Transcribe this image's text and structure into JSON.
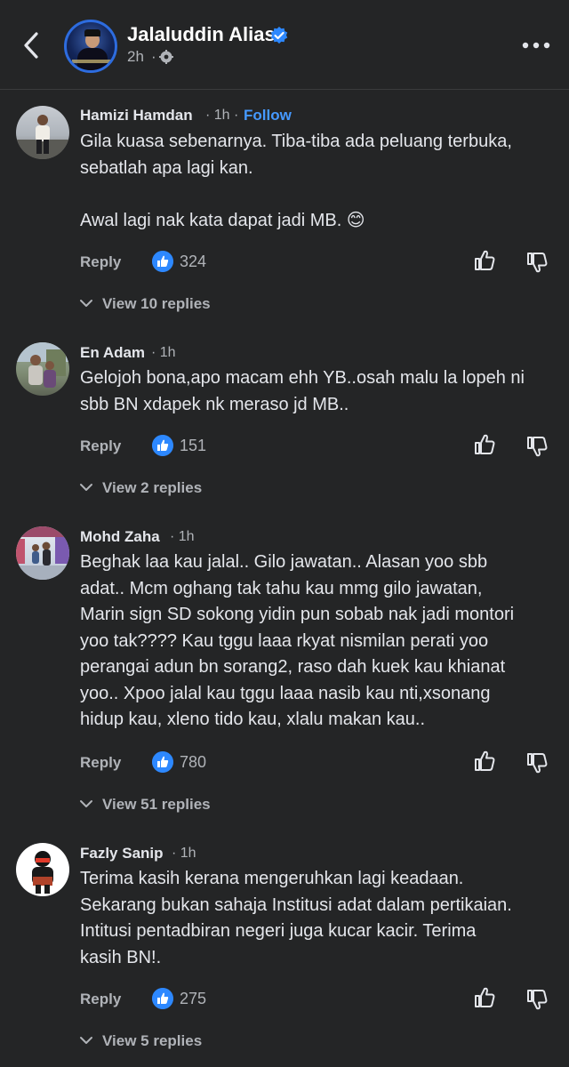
{
  "header": {
    "page_name": "Jalaluddin Alias",
    "time": "2h",
    "dot": "·"
  },
  "comments": [
    {
      "name": "Hamizi Hamdan",
      "meta": "· 1h ·",
      "follow": "Follow",
      "text": "Gila kuasa sebenarnya. Tiba-tiba ada peluang terbuka,\nsebatlah apa lagi kan.\n\nAwal lagi nak kata dapat jadi MB. 😊",
      "reply": "Reply",
      "likes": "324",
      "view_replies": "View 10 replies"
    },
    {
      "name": "En Adam",
      "meta": "· 1h",
      "text": "Gelojoh bona,apo macam ehh YB..osah malu la lopeh ni\nsbb BN xdapek nk meraso jd MB..",
      "reply": "Reply",
      "likes": "151",
      "view_replies": "View 2 replies"
    },
    {
      "name": "Mohd Zaha",
      "meta": "· 1h",
      "text": "Beghak laa kau jalal.. Gilo jawatan.. Alasan yoo sbb\nadat.. Mcm oghang tak tahu kau mmg gilo jawatan,\nMarin sign SD sokong yidin pun sobab nak jadi montori\nyoo tak???? Kau tggu laaa rkyat nismilan perati yoo\nperangai adun bn sorang2, raso dah kuek kau khianat\nyoo.. Xpoo jalal kau tggu laaa nasib kau nti,xsonang\nhidup kau, xleno tido kau, xlalu makan kau..",
      "reply": "Reply",
      "likes": "780",
      "view_replies": "View 51 replies"
    },
    {
      "name": "Fazly Sanip",
      "meta": "· 1h",
      "text": "Terima kasih kerana mengeruhkan lagi keadaan.\nSekarang bukan sahaja Institusi adat dalam pertikaian.\nIntitusi pentadbiran negeri juga kucar kacir. Terima\nkasih BN!.",
      "reply": "Reply",
      "likes": "275",
      "view_replies": "View 5 replies"
    }
  ],
  "colors": {
    "background": "#242526",
    "text": "#e4e6eb",
    "muted": "#b0b3b8",
    "accent": "#2d88ff",
    "follow": "#4599ff"
  },
  "icons": [
    "back-arrow-icon",
    "verified-badge-icon",
    "globe-icon",
    "more-dots-icon",
    "like-badge-icon",
    "thumbs-up-icon",
    "thumbs-down-icon",
    "chevron-down-icon"
  ]
}
